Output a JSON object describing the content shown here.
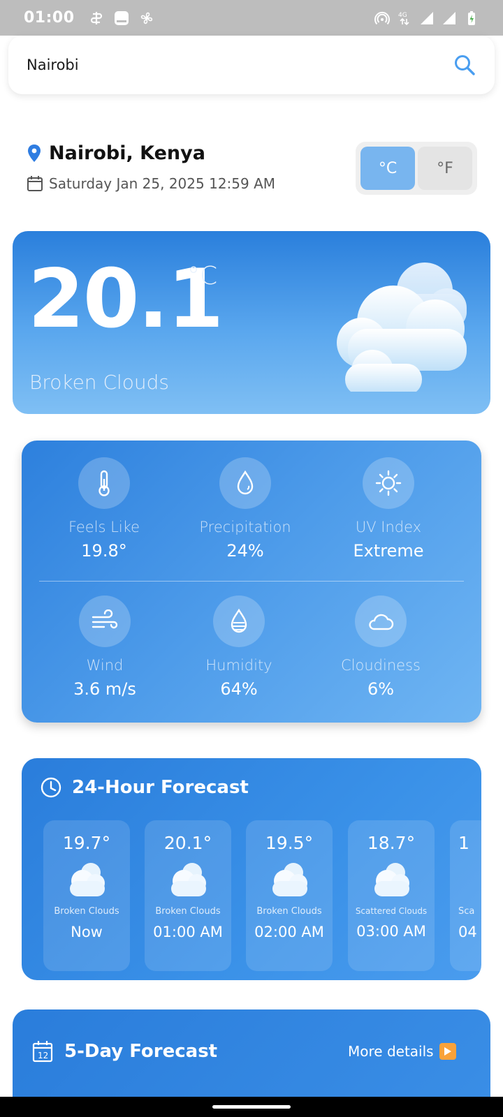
{
  "status_bar": {
    "time": "01:00",
    "network_label": "4G"
  },
  "search": {
    "value": "Nairobi",
    "icon": "search-icon"
  },
  "location": {
    "name": "Nairobi, Kenya",
    "datetime": "Saturday Jan 25, 2025 12:59 AM"
  },
  "unit_toggle": {
    "celsius": "°C",
    "fahrenheit": "°F",
    "selected": "celsius"
  },
  "current": {
    "temperature": "20.1",
    "unit": "°C",
    "condition": "Broken Clouds"
  },
  "details": [
    {
      "label": "Feels Like",
      "value": "19.8°",
      "icon": "thermometer-icon"
    },
    {
      "label": "Precipitation",
      "value": "24%",
      "icon": "droplet-icon"
    },
    {
      "label": "UV Index",
      "value": "Extreme",
      "icon": "sun-icon"
    },
    {
      "label": "Wind",
      "value": "3.6 m/s",
      "icon": "wind-icon"
    },
    {
      "label": "Humidity",
      "value": "64%",
      "icon": "humidity-icon"
    },
    {
      "label": "Cloudiness",
      "value": "6%",
      "icon": "cloud-icon"
    }
  ],
  "hourly": {
    "title": "24-Hour Forecast",
    "items": [
      {
        "temp": "19.7°",
        "condition": "Broken Clouds",
        "time": "Now"
      },
      {
        "temp": "20.1°",
        "condition": "Broken Clouds",
        "time": "01:00 AM"
      },
      {
        "temp": "19.5°",
        "condition": "Broken Clouds",
        "time": "02:00 AM"
      },
      {
        "temp": "18.7°",
        "condition": "Scattered Clouds",
        "time": "03:00 AM"
      },
      {
        "temp": "1",
        "condition": "Sca",
        "time": "04"
      }
    ]
  },
  "five_day": {
    "title": "5-Day Forecast",
    "more_details": "More details"
  },
  "colors": {
    "accent": "#4a9cee",
    "toggle_active": "#78b5ef",
    "more_details_badge": "#f9a23a"
  }
}
